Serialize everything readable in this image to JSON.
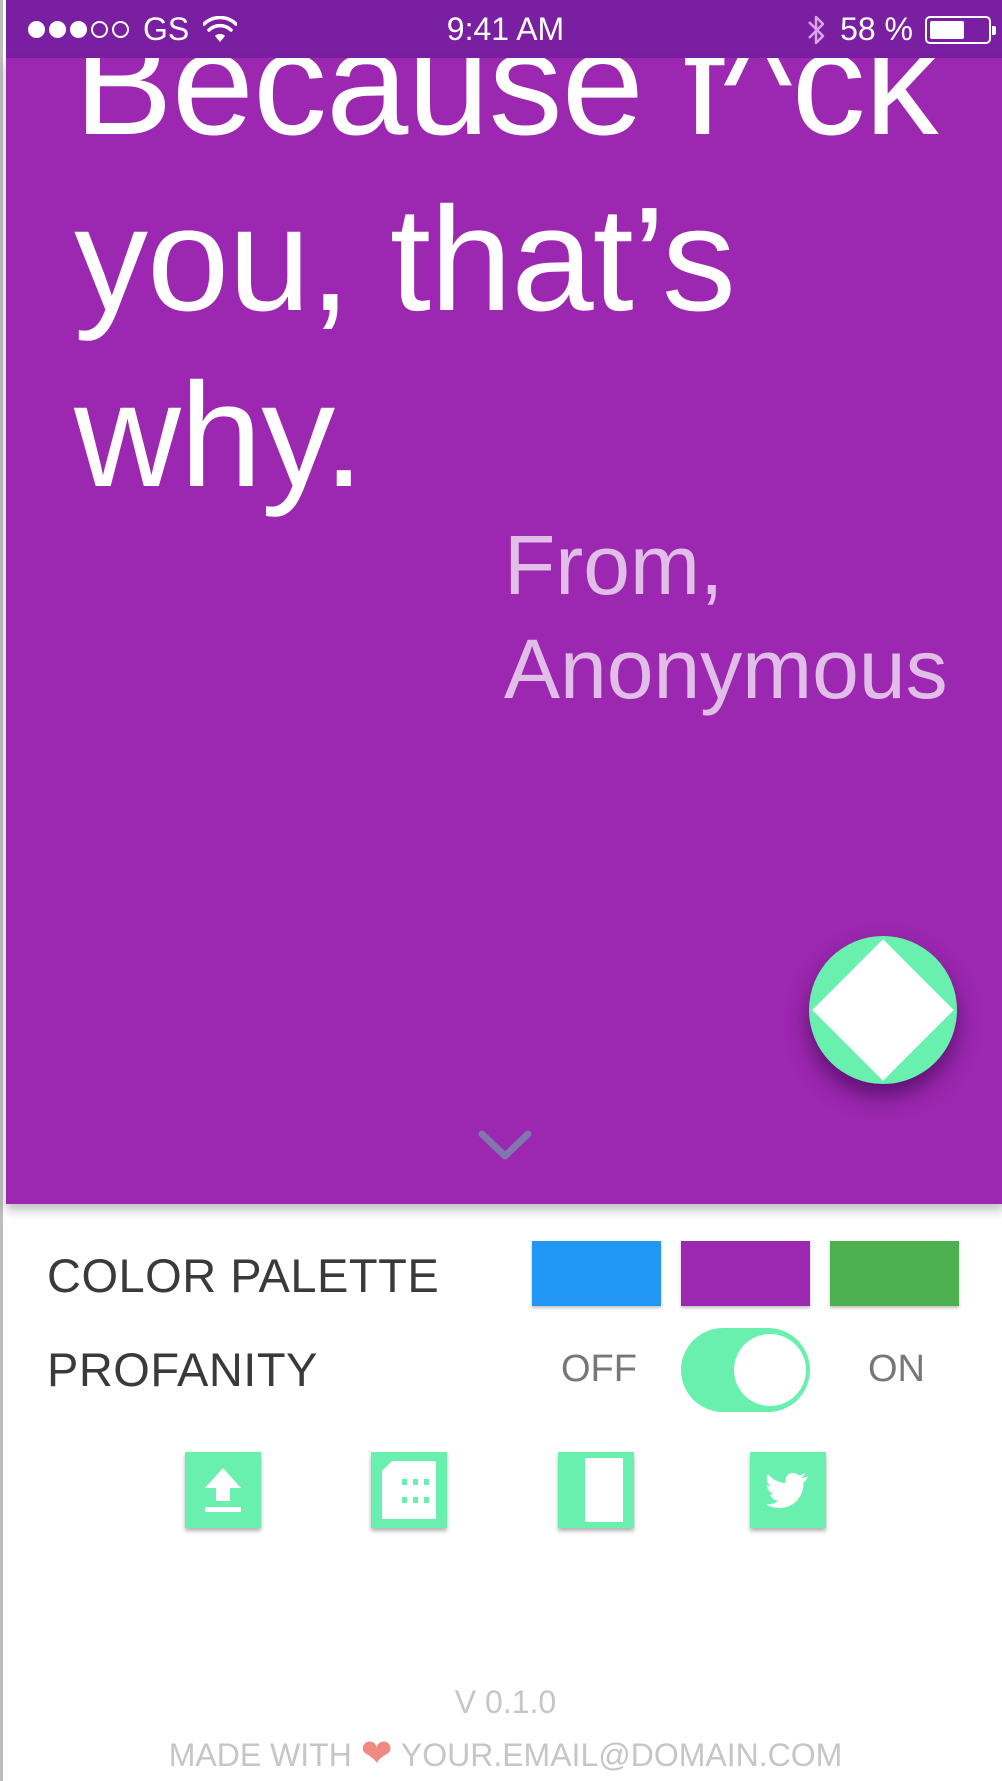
{
  "status_bar": {
    "signal_dots_filled": 3,
    "signal_dots_total": 5,
    "carrier": "GS",
    "time": "9:41 AM",
    "battery_label": "58 %",
    "battery_level": 0.58
  },
  "card": {
    "quote": "Because f^ck you, that’s why.",
    "attribution_line1": "From,",
    "attribution_line2": "Anonymous",
    "background_color": "#9C27B0",
    "fab_icon": "diamond-icon",
    "scroll_icon": "chevron-down-icon"
  },
  "settings": {
    "color_palette_label": "COLOR PALETTE",
    "palette": [
      "#2196F3",
      "#9C27B0",
      "#4CAF50"
    ],
    "profanity_label": "PROFANITY",
    "toggle_off_label": "OFF",
    "toggle_on_label": "ON",
    "profanity_enabled": true,
    "accent_color": "#69F0AE"
  },
  "actions": [
    {
      "icon": "upload-icon"
    },
    {
      "icon": "film-icon"
    },
    {
      "icon": "split-screen-icon"
    },
    {
      "icon": "twitter-icon"
    }
  ],
  "footer": {
    "version": "V 0.1.0",
    "made_with": "MADE WITH",
    "heart": "❤",
    "email": "YOUR.EMAIL@DOMAIN.COM"
  }
}
